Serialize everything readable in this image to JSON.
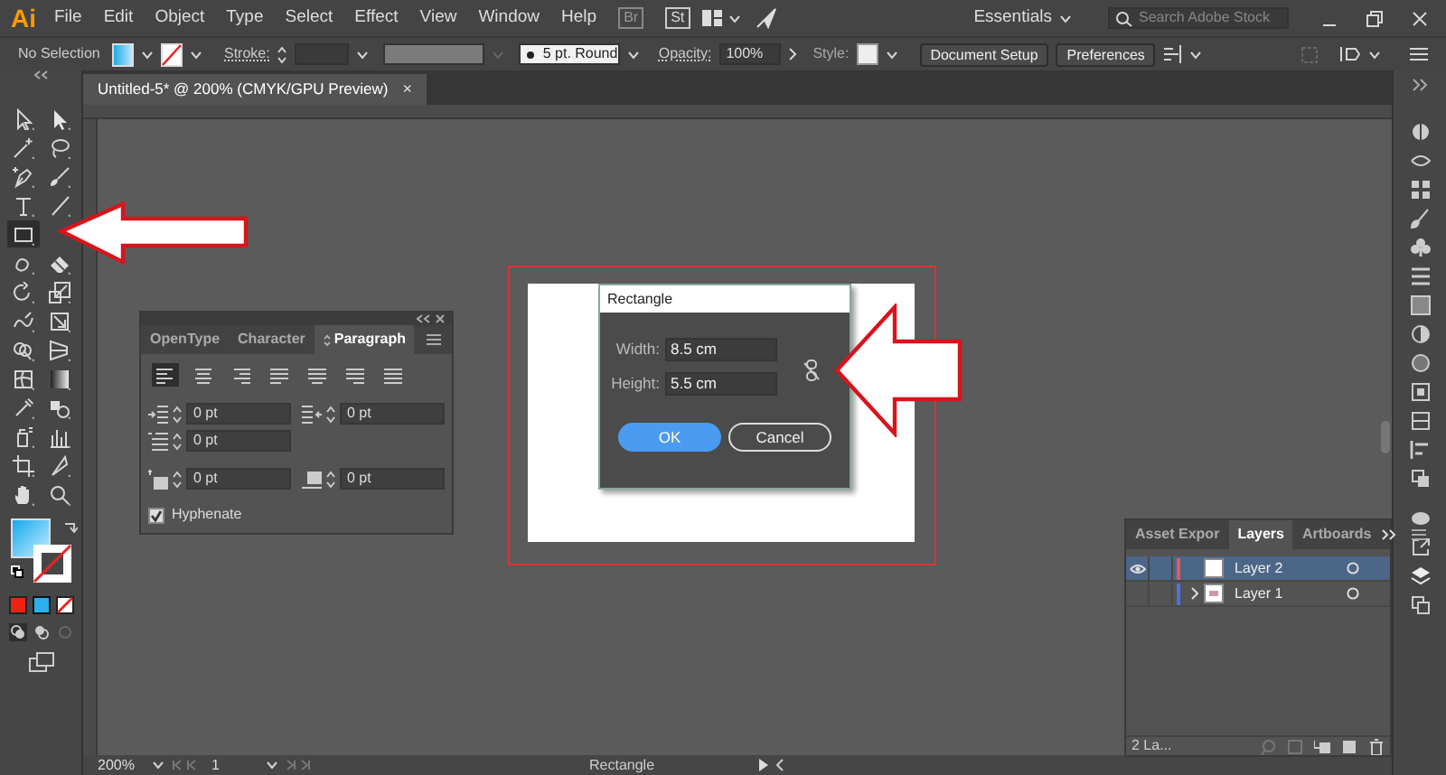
{
  "menubar": {
    "logo": "Ai",
    "menus": [
      "File",
      "Edit",
      "Object",
      "Type",
      "Select",
      "Effect",
      "View",
      "Window",
      "Help"
    ],
    "bridge": "Br",
    "stock": "St",
    "workspace": "Essentials",
    "search": {
      "placeholder": "Search Adobe Stock"
    }
  },
  "control_bar": {
    "selection": "No Selection",
    "stroke_label": "Stroke:",
    "brush": "5 pt. Round",
    "opacity_label": "Opacity:",
    "opacity": "100%",
    "style_label": "Style:",
    "buttons": [
      "Document Setup",
      "Preferences"
    ]
  },
  "document_tab": {
    "title": "Untitled-5* @ 200% (CMYK/GPU Preview)",
    "close": "×"
  },
  "tools": [
    {
      "kind": "selection",
      "selected": false
    },
    {
      "kind": "direct-selection",
      "selected": false
    },
    {
      "kind": "magic-wand",
      "selected": false
    },
    {
      "kind": "lasso",
      "selected": false
    },
    {
      "kind": "pen",
      "selected": false
    },
    {
      "kind": "brush",
      "selected": false
    },
    {
      "kind": "type",
      "selected": false
    },
    {
      "kind": "line",
      "selected": false
    },
    {
      "kind": "rectangle",
      "selected": true
    },
    {
      "kind": "shaper",
      "selected": false
    },
    {
      "kind": "eraser",
      "selected": false
    },
    {
      "kind": "rotate",
      "selected": false
    },
    {
      "kind": "scale",
      "selected": false
    },
    {
      "kind": "warp",
      "selected": false
    },
    {
      "kind": "free-transform",
      "selected": false
    },
    {
      "kind": "shape-builder",
      "selected": false
    },
    {
      "kind": "perspective",
      "selected": false
    },
    {
      "kind": "mesh",
      "selected": false
    },
    {
      "kind": "gradient",
      "selected": false
    },
    {
      "kind": "eyedropper",
      "selected": false
    },
    {
      "kind": "blend",
      "selected": false
    },
    {
      "kind": "symbol-sprayer",
      "selected": false
    },
    {
      "kind": "graph",
      "selected": false
    },
    {
      "kind": "artboard",
      "selected": false
    },
    {
      "kind": "slice",
      "selected": false
    },
    {
      "kind": "hand",
      "selected": false
    },
    {
      "kind": "zoom",
      "selected": false
    }
  ],
  "paragraph_panel": {
    "tabs": [
      {
        "label": "OpenType",
        "selected": false
      },
      {
        "label": "Character",
        "selected": false
      },
      {
        "label": "Paragraph",
        "selected": true
      }
    ],
    "alignments": [
      {
        "kind": "left",
        "selected": true
      },
      {
        "kind": "center",
        "selected": false
      },
      {
        "kind": "right",
        "selected": false
      },
      {
        "kind": "justify-left",
        "selected": false
      },
      {
        "kind": "justify-center",
        "selected": false
      },
      {
        "kind": "justify-right",
        "selected": false
      },
      {
        "kind": "justify-all",
        "selected": false
      }
    ],
    "fields": [
      {
        "kind": "left-indent",
        "value": "0 pt"
      },
      {
        "kind": "right-indent",
        "value": "0 pt"
      },
      {
        "kind": "first-line-indent",
        "value": "0 pt"
      },
      {
        "kind": "space-before",
        "value": "0 pt"
      },
      {
        "kind": "space-after",
        "value": "0 pt"
      }
    ],
    "hyphenate": {
      "label": "Hyphenate",
      "checked": true
    }
  },
  "dialog": {
    "title": "Rectangle",
    "fields": [
      {
        "label": "Width:",
        "value": "8.5 cm"
      },
      {
        "label": "Height:",
        "value": "5.5 cm"
      }
    ],
    "constrain_linked": false,
    "buttons": [
      {
        "label": "OK",
        "kind": "primary"
      },
      {
        "label": "Cancel",
        "kind": "secondary"
      }
    ]
  },
  "layers_panel": {
    "tabs": [
      {
        "label": "Asset Expor",
        "selected": false
      },
      {
        "label": "Layers",
        "selected": true
      },
      {
        "label": "Artboards",
        "selected": false
      }
    ],
    "layers": [
      {
        "name": "Layer 2",
        "color": "#e05a5a",
        "visible": true,
        "selected": true,
        "expandable": false
      },
      {
        "name": "Layer 1",
        "color": "#4f6fe0",
        "visible": false,
        "selected": false,
        "expandable": true
      }
    ],
    "count": "2 La..."
  },
  "status_bar": {
    "zoom": "200%",
    "page": "1",
    "tool": "Rectangle"
  }
}
